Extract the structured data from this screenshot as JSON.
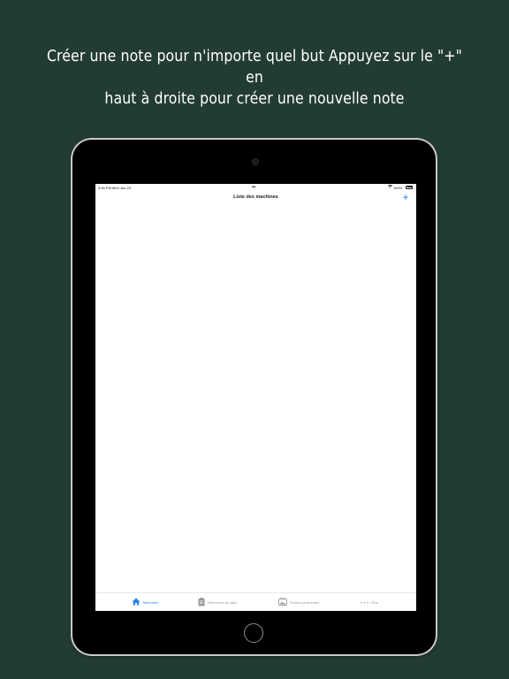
{
  "headline": {
    "line1": "Créer une note pour n'importe quel but Appuyez sur le \"+\" en",
    "line2": "haut à droite pour créer une nouvelle note"
  },
  "status_bar": {
    "time": "4:05 PM   Mon Jun 24",
    "dots": "•••",
    "battery": "100%"
  },
  "nav": {
    "title": "Liste des machines",
    "add_label": "+"
  },
  "tabs": [
    {
      "label": "Machines",
      "icon": "house-icon"
    },
    {
      "label": "Référence de taille",
      "icon": "clipboard-icon"
    },
    {
      "label": "Photos pertinentes",
      "icon": "photos-icon"
    },
    {
      "label": "Plus",
      "icon": "more-icon"
    }
  ],
  "colors": {
    "background": "#233b35",
    "accent": "#2a83f5",
    "inactive_tab": "#9a9a9a"
  }
}
